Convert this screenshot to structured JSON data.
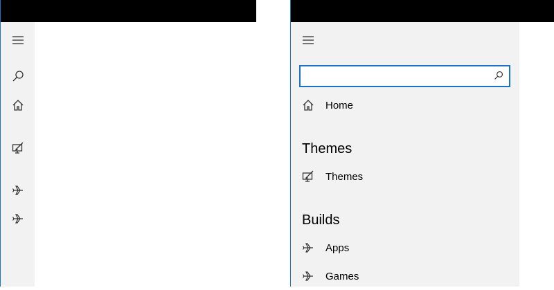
{
  "left_window": {
    "pane": {
      "hamburger_icon": "hamburger-icon",
      "items": [
        {
          "name": "search",
          "icon": "search-icon"
        },
        {
          "name": "home",
          "icon": "home-icon"
        },
        {
          "name": "themes",
          "icon": "themes-icon"
        },
        {
          "name": "apps",
          "icon": "airplane-icon"
        },
        {
          "name": "games",
          "icon": "airplane-icon"
        }
      ]
    }
  },
  "right_window": {
    "pane": {
      "search": {
        "placeholder": "",
        "value": ""
      },
      "home_label": "Home",
      "sections": [
        {
          "header": "Themes",
          "items": [
            {
              "label": "Themes",
              "icon": "themes-icon"
            }
          ]
        },
        {
          "header": "Builds",
          "items": [
            {
              "label": "Apps",
              "icon": "airplane-icon"
            },
            {
              "label": "Games",
              "icon": "airplane-icon"
            }
          ]
        }
      ]
    }
  },
  "colors": {
    "titlebar": "#000000",
    "pane": "#f2f2f2",
    "accent": "#1a73c9"
  }
}
